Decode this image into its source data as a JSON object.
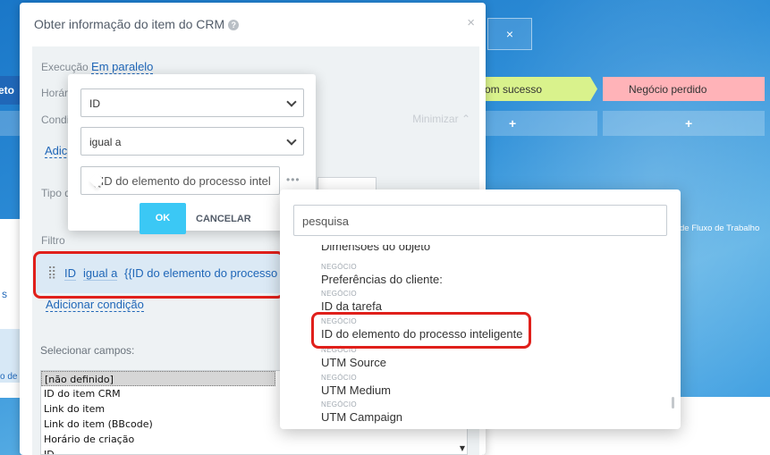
{
  "background": {
    "strip_label": "eto",
    "stage_success": "om sucesso",
    "stage_lost": "Negócio perdido",
    "plus": "+",
    "tab_close": "×",
    "left_text_1": "s",
    "left_text_2": "o de Tr",
    "flow_text": "de Fluxo de Trabalho"
  },
  "dialog": {
    "title": "Obter informação do item do CRM",
    "help_icon": "?",
    "close": "×",
    "execution_label": "Execução",
    "execution_value": "Em paralelo",
    "hour_label": "Horár",
    "condition_label": "Condi",
    "minimize": "Minimizar",
    "add_link": "Adicio",
    "type_label": "Tipo d",
    "filter_label": "Filtro",
    "filter": {
      "handle": "⣿",
      "field": "ID",
      "op": "igual a",
      "value": "{{ID do elemento do processo int"
    },
    "add_condition": "Adicionar condição",
    "select_fields_label": "Selecionar campos:",
    "fields": [
      "[não definido]",
      "ID do item CRM",
      "Link do item",
      "Link do item (BBcode)",
      "Horário de criação",
      "ID"
    ]
  },
  "popup": {
    "field": "ID",
    "operator": "igual a",
    "value": "{{ID do elemento do processo intel",
    "more": "•••",
    "ok": "OK",
    "cancel": "CANCELAR"
  },
  "selector": {
    "search_placeholder": "pesquisa",
    "items": [
      {
        "cat": "",
        "name": "Dimensões do objeto"
      },
      {
        "cat": "NEGÓCIO",
        "name": "Preferências do cliente:"
      },
      {
        "cat": "NEGÓCIO",
        "name": "ID da tarefa"
      },
      {
        "cat": "NEGÓCIO",
        "name": "ID do elemento do processo inteligente"
      },
      {
        "cat": "NEGÓCIO",
        "name": "UTM Source"
      },
      {
        "cat": "NEGÓCIO",
        "name": "UTM Medium"
      },
      {
        "cat": "NEGÓCIO",
        "name": "UTM Campaign"
      }
    ]
  }
}
